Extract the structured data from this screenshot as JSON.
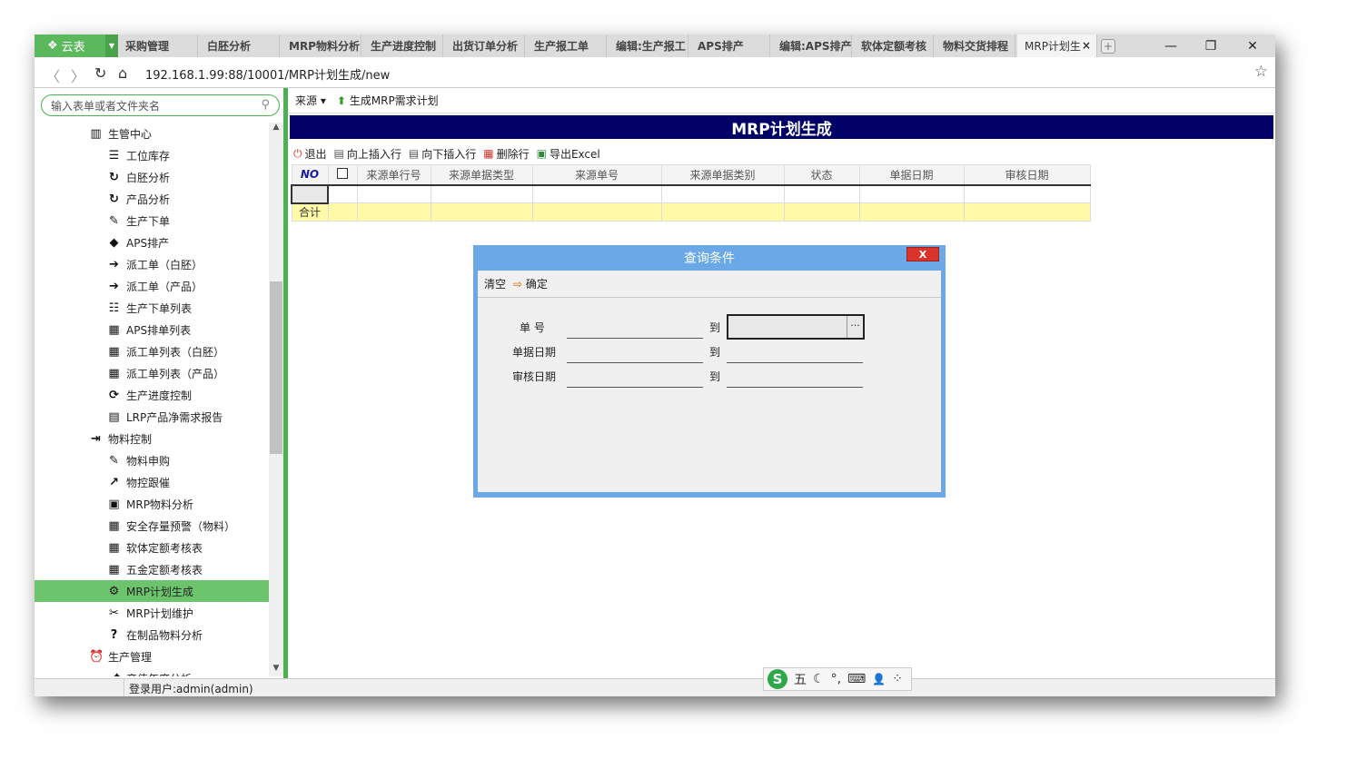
{
  "browser": {
    "logo_label": "云表",
    "tabs": [
      "采购管理",
      "白胚分析",
      "MRP物料分析",
      "生产进度控制",
      "出货订单分析",
      "生产报工单",
      "编辑:生产报工",
      "APS排产",
      "编辑:APS排产",
      "软体定额考核",
      "物料交货排程",
      "MRP计划生"
    ],
    "active_tab_close": "×",
    "new_tab": "+",
    "window_controls": {
      "minimize": "—",
      "maximize": "❐",
      "close": "✕"
    },
    "url": "192.168.1.99:88/10001/MRP计划生成/new"
  },
  "sidebar": {
    "search_placeholder": "输入表单或者文件夹名",
    "items": [
      {
        "label": "生管中心",
        "icon": "barcode-icon",
        "glyph": "▥",
        "level": 1
      },
      {
        "label": "工位库存",
        "icon": "database-icon",
        "glyph": "☰",
        "level": 2
      },
      {
        "label": "白胚分析",
        "icon": "cycle-icon",
        "glyph": "↻",
        "level": 2
      },
      {
        "label": "产品分析",
        "icon": "cycle-icon",
        "glyph": "↻",
        "level": 2
      },
      {
        "label": "生产下单",
        "icon": "edit-doc-icon",
        "glyph": "✎",
        "level": 2
      },
      {
        "label": "APS排产",
        "icon": "cube-icon",
        "glyph": "◆",
        "level": 2
      },
      {
        "label": "派工单（白胚）",
        "icon": "sign-in-icon",
        "glyph": "➔",
        "level": 2
      },
      {
        "label": "派工单（产品）",
        "icon": "sign-in-icon",
        "glyph": "➔",
        "level": 2
      },
      {
        "label": "生产下单列表",
        "icon": "list-icon",
        "glyph": "☷",
        "level": 2
      },
      {
        "label": "APS排单列表",
        "icon": "grid-list-icon",
        "glyph": "▦",
        "level": 2
      },
      {
        "label": "派工单列表（白胚）",
        "icon": "grid-list-icon",
        "glyph": "▦",
        "level": 2
      },
      {
        "label": "派工单列表（产品）",
        "icon": "grid-list-icon",
        "glyph": "▦",
        "level": 2
      },
      {
        "label": "生产进度控制",
        "icon": "refresh-icon",
        "glyph": "⟳",
        "level": 2
      },
      {
        "label": "LRP产品净需求报告",
        "icon": "calendar-icon",
        "glyph": "▤",
        "level": 2
      },
      {
        "label": "物料控制",
        "icon": "login-box-icon",
        "glyph": "⇥",
        "level": 1
      },
      {
        "label": "物料申购",
        "icon": "edit-doc-icon",
        "glyph": "✎",
        "level": 2
      },
      {
        "label": "物控跟催",
        "icon": "share-icon",
        "glyph": "↗",
        "level": 2
      },
      {
        "label": "MRP物料分析",
        "icon": "module-icon",
        "glyph": "▣",
        "level": 2
      },
      {
        "label": "安全存量预警（物料）",
        "icon": "grid-list-icon",
        "glyph": "▦",
        "level": 2
      },
      {
        "label": "软体定额考核表",
        "icon": "table-icon",
        "glyph": "▦",
        "level": 2
      },
      {
        "label": "五金定额考核表",
        "icon": "table-icon",
        "glyph": "▦",
        "level": 2
      },
      {
        "label": "MRP计划生成",
        "icon": "gear-icon",
        "glyph": "⚙",
        "level": 2,
        "selected": true
      },
      {
        "label": "MRP计划维护",
        "icon": "tools-icon",
        "glyph": "✂",
        "level": 2
      },
      {
        "label": "在制品物料分析",
        "icon": "question-icon",
        "glyph": "?",
        "level": 2
      },
      {
        "label": "生产管理",
        "icon": "alarm-icon",
        "glyph": "⏰",
        "level": 1
      },
      {
        "label": "产值年度分析",
        "icon": "chart-line-icon",
        "glyph": "⤴",
        "level": 2
      }
    ]
  },
  "main": {
    "top_toolbar": {
      "source_label": "来源",
      "generate_label": "生成MRP需求计划"
    },
    "title": "MRP计划生成",
    "grid_toolbar": [
      {
        "label": "退出",
        "icon": "power-icon",
        "glyph": "⏻",
        "color": "#d9342b"
      },
      {
        "label": "向上插入行",
        "icon": "insert-above-icon",
        "glyph": "▤",
        "color": "#555555"
      },
      {
        "label": "向下插入行",
        "icon": "insert-below-icon",
        "glyph": "▤",
        "color": "#555555"
      },
      {
        "label": "删除行",
        "icon": "delete-row-icon",
        "glyph": "▦",
        "color": "#d9342b"
      },
      {
        "label": "导出Excel",
        "icon": "excel-icon",
        "glyph": "▣",
        "color": "#2e8b3a"
      }
    ],
    "grid": {
      "no_label": "NO",
      "columns": [
        "来源单行号",
        "来源单据类型",
        "来源单号",
        "来源单据类别",
        "状态",
        "单据日期",
        "审核日期"
      ],
      "sum_label": "合计"
    }
  },
  "dialog": {
    "title": "查询条件",
    "close_label": "X",
    "clear_label": "清空",
    "ok_label": "确定",
    "fields": [
      {
        "label": "单 号",
        "to": "到"
      },
      {
        "label": "单据日期",
        "to": "到"
      },
      {
        "label": "审核日期",
        "to": "到"
      }
    ],
    "picker_button": "···"
  },
  "status": {
    "login_text": "登录用户:admin(admin)"
  },
  "ime": {
    "logo": "S",
    "mode": "五",
    "icons": [
      "☾",
      "°,",
      "⌨",
      "👤",
      "⁘"
    ]
  }
}
